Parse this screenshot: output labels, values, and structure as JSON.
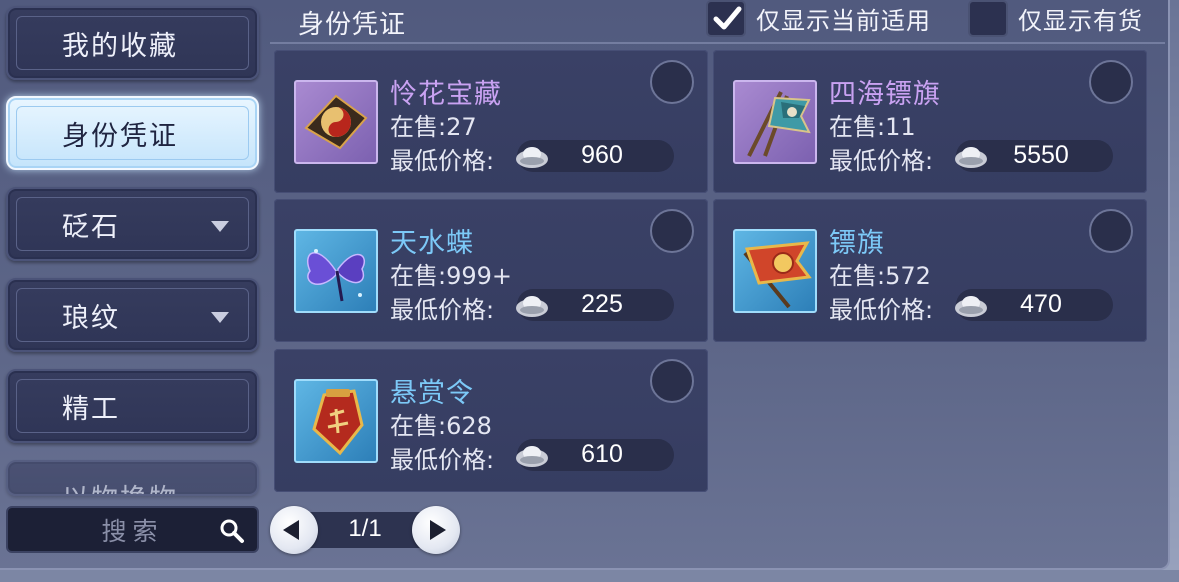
{
  "sidebar": {
    "items": [
      {
        "label": "我的收藏"
      },
      {
        "label": "身份凭证"
      },
      {
        "label": "砭石"
      },
      {
        "label": "琅纹"
      },
      {
        "label": "精工"
      },
      {
        "label": "以物换物"
      }
    ],
    "search_placeholder": "搜索"
  },
  "header": {
    "title": "身份凭证",
    "filter_current": "仅显示当前适用",
    "filter_current_checked": true,
    "filter_stock": "仅显示有货",
    "filter_stock_checked": false
  },
  "labels": {
    "stock_prefix": "在售:",
    "price_label": "最低价格:"
  },
  "items": [
    {
      "name": "怜花宝藏",
      "stock": "在售:27",
      "price": "960",
      "rarity_color": "#c9a2f2",
      "icon": "treasure-compass-icon"
    },
    {
      "name": "四海镖旗",
      "stock": "在售:11",
      "price": "5550",
      "rarity_color": "#c9a2f2",
      "icon": "escort-flags-icon"
    },
    {
      "name": "天水蝶",
      "stock": "在售:999+",
      "price": "225",
      "rarity_color": "#7cc9f7",
      "icon": "butterfly-icon"
    },
    {
      "name": "镖旗",
      "stock": "在售:572",
      "price": "470",
      "rarity_color": "#7cc9f7",
      "icon": "escort-flag-icon"
    },
    {
      "name": "悬赏令",
      "stock": "在售:628",
      "price": "610",
      "rarity_color": "#7cc9f7",
      "icon": "bounty-token-icon"
    }
  ],
  "pager": {
    "text": "1/1"
  },
  "colors": {
    "accent_active": "#c4e4fb",
    "panel": "#3a4166"
  }
}
